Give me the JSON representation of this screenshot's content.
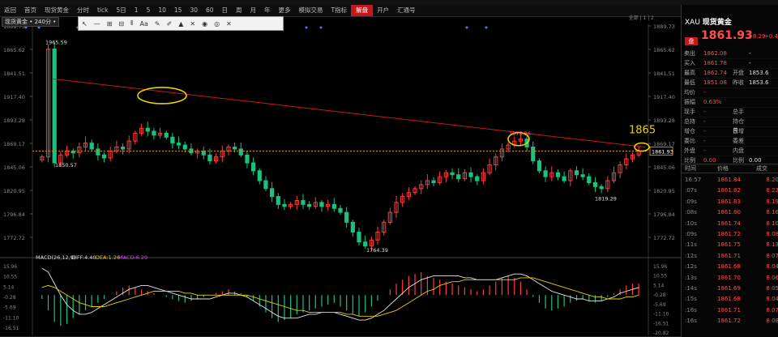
{
  "toolbar": {
    "items": [
      "返回",
      "首页",
      "现货黄金",
      "分时",
      "tick",
      "5日",
      "1",
      "5",
      "10",
      "15",
      "30",
      "60",
      "日",
      "周",
      "月",
      "年",
      "更多",
      "模拟交易",
      "T指标",
      "解盘",
      "开户",
      "汇通号"
    ],
    "highlight": "解盘"
  },
  "chart_header": {
    "title": "现货黄金 • 240分 •",
    "right_label": "全部 | 1 | 2"
  },
  "drawing_toolbar": {
    "items": [
      "↖",
      "—",
      "⊞",
      "⊟",
      "⫴",
      "Aa",
      "✎",
      "✐",
      "▲",
      "✕",
      "◉",
      "◎",
      "✕"
    ]
  },
  "quote_panel": {
    "symbol": "XAU",
    "name": "现货黄金",
    "badge": "盘",
    "price": "1861.93",
    "arrow": "↑",
    "change": "+8.29",
    "change_pct": "+0.45%",
    "rows": [
      {
        "k": "卖出",
        "v": "1862.08",
        "k2": "",
        "v2": "-"
      },
      {
        "k": "买入",
        "v": "1861.78",
        "k2": "",
        "v2": "-"
      },
      {
        "k": "最高",
        "v": "1862.74",
        "k2": "开盘",
        "v2": "1853.6"
      },
      {
        "k": "最低",
        "v": "1851.08",
        "k2": "昨收",
        "v2": "1853.6"
      },
      {
        "k": "均价",
        "v": "-",
        "k2": "",
        "v2": ""
      },
      {
        "k": "振幅",
        "v": "0.63%",
        "k2": "",
        "v2": ""
      },
      {
        "k": "现手",
        "v": "-",
        "k2": "总手",
        "v2": ""
      },
      {
        "k": "总持",
        "v": "-",
        "k2": "持仓差",
        "v2": ""
      },
      {
        "k": "增仓",
        "v": "-",
        "k2": "日增",
        "v2": ""
      },
      {
        "k": "委比",
        "v": "-",
        "k2": "委差",
        "v2": ""
      },
      {
        "k": "外盘",
        "v": "-",
        "k2": "内盘",
        "v2": ""
      },
      {
        "k": "比例",
        "v": "0.00",
        "k2": "比例",
        "v2": "0.00"
      }
    ],
    "ticks_header": {
      "time": "时间",
      "price": "价格",
      "qty": "成交"
    },
    "ticks": [
      {
        "t": "16:57",
        "p": "1861.84",
        "q": "8.20"
      },
      {
        "t": ":07s",
        "p": "1861.82",
        "q": "8.23"
      },
      {
        "t": ":09s",
        "p": "1861.83",
        "q": "8.19"
      },
      {
        "t": ":08s",
        "p": "1861.80",
        "q": "8.16"
      },
      {
        "t": ":10s",
        "p": "1861.74",
        "q": "8.10"
      },
      {
        "t": ":09s",
        "p": "1861.72",
        "q": "8.08"
      },
      {
        "t": ":11s",
        "p": "1861.75",
        "q": "8.13"
      },
      {
        "t": ":12s",
        "p": "1861.71",
        "q": "8.07"
      },
      {
        "t": ":12s",
        "p": "1861.68",
        "q": "8.04"
      },
      {
        "t": ":13s",
        "p": "1861.70",
        "q": "8.06"
      },
      {
        "t": ":14s",
        "p": "1861.69",
        "q": "8.05"
      },
      {
        "t": ":15s",
        "p": "1861.68",
        "q": "8.04"
      },
      {
        "t": ":16s",
        "p": "1861.71",
        "q": "8.07"
      },
      {
        "t": ":16s",
        "p": "1861.72",
        "q": "8.08"
      }
    ]
  },
  "chart_data": {
    "type": "candlestick",
    "y_ticks": [
      "1889.73",
      "1865.62",
      "1841.51",
      "1917.40",
      "1893.28",
      "1869.17",
      "1845.06",
      "1820.95",
      "1796.84",
      "1772.72"
    ],
    "y_ticks_right": [
      "1889.73",
      "1865.62",
      "1841.51",
      "1917.40",
      "1893.28",
      "1869.17",
      "1845.06",
      "1820.95",
      "1796.84",
      "1772.72"
    ],
    "ylim": [
      1760,
      1990
    ],
    "current_price": "1861.93",
    "annotations": [
      {
        "text": "1965.59"
      },
      {
        "text": "1850.57"
      },
      {
        "text": "1764.39"
      },
      {
        "text": "1819.29"
      },
      {
        "text": "1875.86"
      }
    ],
    "callout": "1865",
    "candles_close": [
      1856,
      1965,
      1850,
      1858,
      1862,
      1860,
      1866,
      1870,
      1864,
      1858,
      1855,
      1862,
      1866,
      1864,
      1872,
      1880,
      1885,
      1882,
      1878,
      1880,
      1876,
      1870,
      1868,
      1864,
      1860,
      1862,
      1858,
      1852,
      1856,
      1862,
      1866,
      1864,
      1858,
      1850,
      1842,
      1832,
      1824,
      1816,
      1808,
      1806,
      1808,
      1812,
      1808,
      1806,
      1810,
      1806,
      1808,
      1804,
      1800,
      1790,
      1780,
      1770,
      1766,
      1772,
      1780,
      1790,
      1800,
      1810,
      1816,
      1820,
      1824,
      1828,
      1832,
      1830,
      1836,
      1840,
      1838,
      1834,
      1840,
      1836,
      1832,
      1840,
      1848,
      1856,
      1864,
      1868,
      1872,
      1874,
      1866,
      1852,
      1842,
      1836,
      1840,
      1836,
      1832,
      1842,
      1838,
      1836,
      1830,
      1826,
      1824,
      1832,
      1840,
      1848,
      1854,
      1858,
      1862
    ],
    "macd": {
      "label": "MACD(26,12,9)",
      "diff_label": "DIFF:4.40",
      "dea_label": "DEA:1.26",
      "macd_label": "MACD:6.29",
      "y_ticks": [
        "15.96",
        "10.55",
        "5.14",
        "-0.28",
        "-5.69",
        "-11.10",
        "-16.51"
      ],
      "y_ticks_right": [
        "15.96",
        "10.55",
        "5.14",
        "-0.28",
        "-5.69",
        "-11.10",
        "-16.51",
        "-20.82"
      ],
      "ylim": [
        -21,
        17
      ],
      "hist": [
        -2,
        -8,
        -14,
        -16,
        -15,
        -12,
        -10,
        -8,
        -6,
        -4,
        -2,
        0,
        2,
        4,
        5,
        4,
        3,
        2,
        1,
        0,
        -1,
        -2,
        -3,
        -4,
        -3,
        -2,
        -1,
        0,
        1,
        2,
        3,
        2,
        1,
        -1,
        -3,
        -6,
        -9,
        -12,
        -14,
        -13,
        -12,
        -10,
        -9,
        -8,
        -7,
        -6,
        -5,
        -4,
        -6,
        -8,
        -10,
        -11,
        -9,
        -6,
        -3,
        0,
        3,
        6,
        8,
        10,
        11,
        12,
        10,
        9,
        8,
        7,
        6,
        5,
        4,
        3,
        2,
        3,
        5,
        7,
        9,
        10,
        9,
        7,
        3,
        -1,
        -4,
        -7,
        -8,
        -7,
        -6,
        -4,
        -3,
        -2,
        -3,
        -4,
        -3,
        -1,
        1,
        3,
        5,
        6,
        6
      ],
      "diff": [
        14,
        12,
        6,
        0,
        -5,
        -8,
        -10,
        -10,
        -9,
        -7,
        -5,
        -3,
        -1,
        1,
        3,
        4,
        5,
        5,
        4,
        3,
        2,
        1,
        0,
        -1,
        -2,
        -2,
        -2,
        -2,
        -1,
        0,
        1,
        1,
        0,
        -1,
        -3,
        -5,
        -7,
        -9,
        -11,
        -12,
        -12,
        -12,
        -11,
        -10,
        -10,
        -9,
        -9,
        -9,
        -10,
        -11,
        -12,
        -13,
        -13,
        -12,
        -10,
        -8,
        -5,
        -2,
        1,
        4,
        6,
        8,
        9,
        10,
        10,
        10,
        10,
        10,
        9,
        9,
        8,
        8,
        8,
        8,
        9,
        10,
        11,
        11,
        10,
        8,
        6,
        4,
        2,
        1,
        0,
        -1,
        -2,
        -2,
        -3,
        -3,
        -3,
        -2,
        -1,
        1,
        2,
        3,
        4
      ],
      "dea": [
        4,
        5,
        4,
        2,
        0,
        -2,
        -4,
        -5,
        -6,
        -6,
        -6,
        -5,
        -4,
        -3,
        -2,
        -1,
        0,
        1,
        2,
        2,
        2,
        2,
        2,
        1,
        1,
        0,
        0,
        0,
        0,
        0,
        0,
        0,
        0,
        0,
        -1,
        -2,
        -3,
        -4,
        -5,
        -6,
        -7,
        -8,
        -8,
        -9,
        -9,
        -9,
        -9,
        -9,
        -9,
        -10,
        -10,
        -11,
        -11,
        -11,
        -11,
        -10,
        -9,
        -8,
        -6,
        -4,
        -2,
        0,
        2,
        3,
        5,
        6,
        7,
        7,
        8,
        8,
        8,
        8,
        8,
        8,
        8,
        8,
        8,
        9,
        9,
        9,
        8,
        7,
        6,
        5,
        4,
        3,
        2,
        1,
        0,
        -1,
        -1,
        -2,
        -2,
        -2,
        -1,
        -1,
        0
      ]
    },
    "rsi_label": "RSI(6,12,24) RSI1:83.96 RSI2:67.68 RSI3:58.80"
  }
}
